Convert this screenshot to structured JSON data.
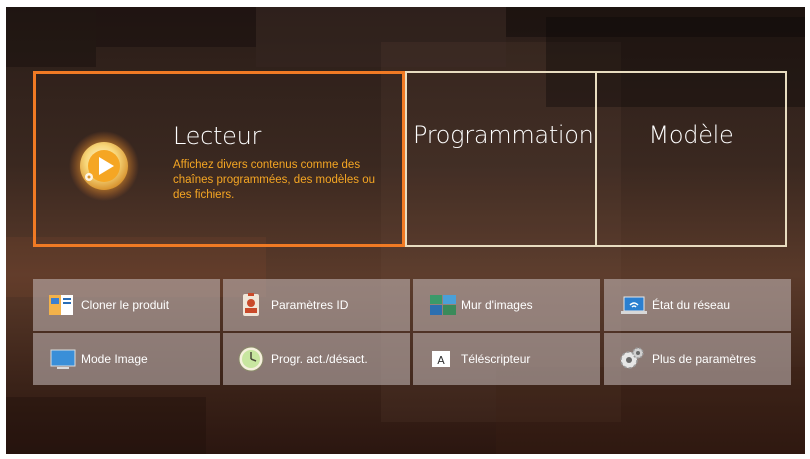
{
  "main_tiles": {
    "player": {
      "title": "Lecteur",
      "description": "Affichez divers contenus comme des chaînes programmées, des modèles ou des fichiers.",
      "icon": "play-icon",
      "selected": true
    },
    "schedule": {
      "title": "Programmation"
    },
    "template": {
      "title": "Modèle"
    }
  },
  "menu": {
    "items": [
      {
        "label": "Cloner le produit",
        "icon": "clone-product-icon"
      },
      {
        "label": "Paramètres ID",
        "icon": "id-badge-icon"
      },
      {
        "label": "Mur d'images",
        "icon": "video-wall-icon"
      },
      {
        "label": "État du réseau",
        "icon": "network-laptop-icon"
      },
      {
        "label": "Mode Image",
        "icon": "monitor-icon"
      },
      {
        "label": "Progr. act./désact.",
        "icon": "power-timer-icon"
      },
      {
        "label": "Téléscripteur",
        "icon": "ticker-icon"
      },
      {
        "label": "Plus de paramètres",
        "icon": "gears-icon"
      }
    ]
  },
  "colors": {
    "accent": "#f07a24",
    "description_text": "#f5a623",
    "tile_border": "#e8dcc0"
  }
}
